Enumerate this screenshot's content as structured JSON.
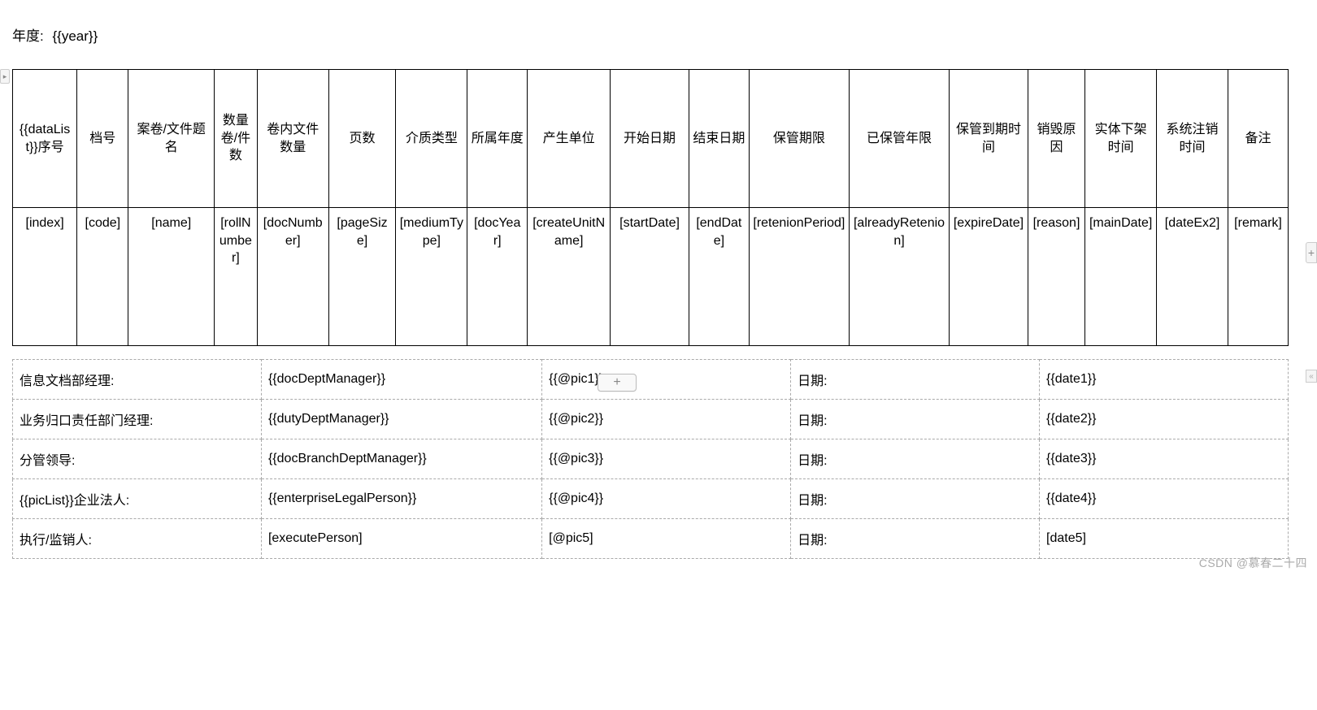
{
  "year": {
    "label": "年度:",
    "value": "{{year}}"
  },
  "chart_data": {
    "type": "table",
    "headers": [
      "{{dataList}}序号",
      "档号",
      "案卷/文件题名",
      "数量卷/件数",
      "卷内文件数量",
      "页数",
      "介质类型",
      "所属年度",
      "产生单位",
      "开始日期",
      "结束日期",
      "保管期限",
      "已保管年限",
      "保管到期时间",
      "销毁原因",
      "实体下架时间",
      "系统注销时间",
      "备注"
    ],
    "rows": [
      [
        "[index]",
        "[code]",
        "[name]",
        "[rollNumber]",
        "[docNumber]",
        "[pageSize]",
        "[mediumType]",
        "[docYear]",
        "[createUnitName]",
        "[startDate]",
        "[endDate]",
        "[retenionPeriod]",
        "[alreadyRetenion]",
        "[expireDate]",
        "[reason]",
        "[mainDate]",
        "[dateEx2]",
        "[remark]"
      ]
    ]
  },
  "addButton": "+",
  "signatures": {
    "rows": [
      {
        "label": "信息文档部经理:",
        "value": "{{docDeptManager}}",
        "pic": "{{@pic1}}",
        "dateLabel": "日期:",
        "date": "{{date1}}"
      },
      {
        "label": "业务归口责任部门经理:",
        "value": "{{dutyDeptManager}}",
        "pic": "{{@pic2}}",
        "dateLabel": "日期:",
        "date": "{{date2}}"
      },
      {
        "label": "分管领导:",
        "value": "{{docBranchDeptManager}}",
        "pic": "{{@pic3}}",
        "dateLabel": "日期:",
        "date": "{{date3}}"
      },
      {
        "label": "{{picList}}企业法人:",
        "value": "{{enterpriseLegalPerson}}",
        "pic": "{{@pic4}}",
        "dateLabel": "日期:",
        "date": "{{date4}}"
      },
      {
        "label": "执行/监销人:",
        "value": "[executePerson]",
        "pic": "[@pic5]",
        "dateLabel": "日期:",
        "date": "[date5]"
      }
    ]
  },
  "rightHandle": "+",
  "watermark": "CSDN @慕春二十四"
}
